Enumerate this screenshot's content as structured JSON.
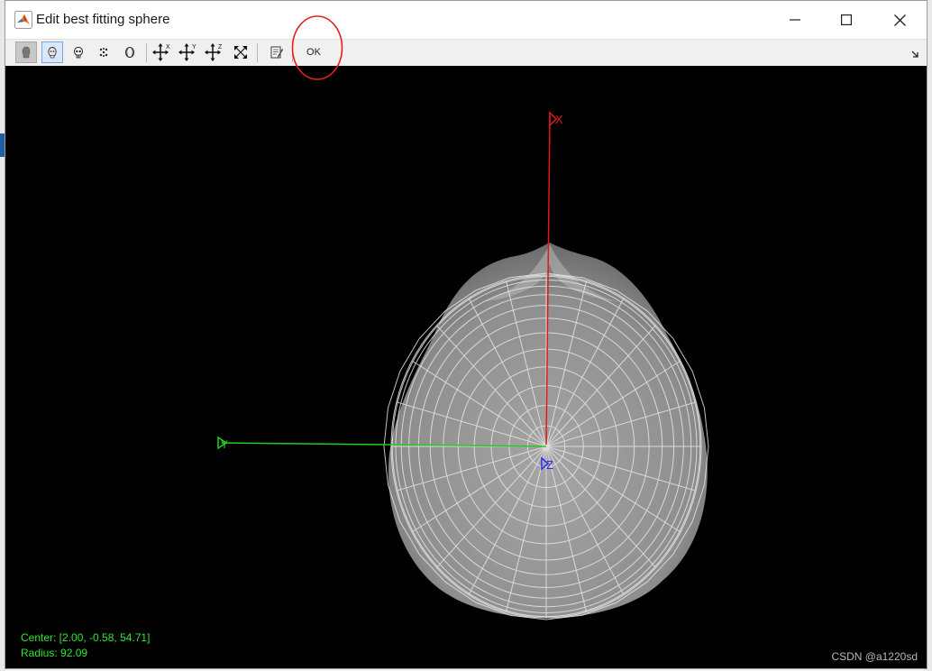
{
  "window": {
    "title": "Edit best fitting sphere"
  },
  "toolbar": {
    "tools": [
      {
        "icon": "head-outline-icon",
        "state": "pressed"
      },
      {
        "icon": "head-surface-icon",
        "state": "active"
      },
      {
        "icon": "skull-icon",
        "state": "normal"
      },
      {
        "icon": "points-icon",
        "state": "normal"
      },
      {
        "icon": "sphere-icon",
        "state": "normal"
      },
      {
        "icon": "move-x-icon",
        "state": "normal"
      },
      {
        "icon": "move-y-icon",
        "state": "normal"
      },
      {
        "icon": "move-z-icon",
        "state": "normal"
      },
      {
        "icon": "resize-icon",
        "state": "normal"
      },
      {
        "icon": "edit-icon",
        "state": "normal"
      }
    ],
    "ok_label": "OK"
  },
  "viewport": {
    "axis_labels": {
      "x": "X",
      "y": "Y",
      "z": "Z"
    },
    "axis_colors": {
      "x": "#e01818",
      "y": "#22cc22",
      "z": "#2a2ae8"
    },
    "center_text": "Center: [2.00, -0.58, 54.71]",
    "radius_text": "Radius: 92.09"
  },
  "watermark": "CSDN @a1220sd",
  "annotation": {
    "color": "#e02020"
  }
}
